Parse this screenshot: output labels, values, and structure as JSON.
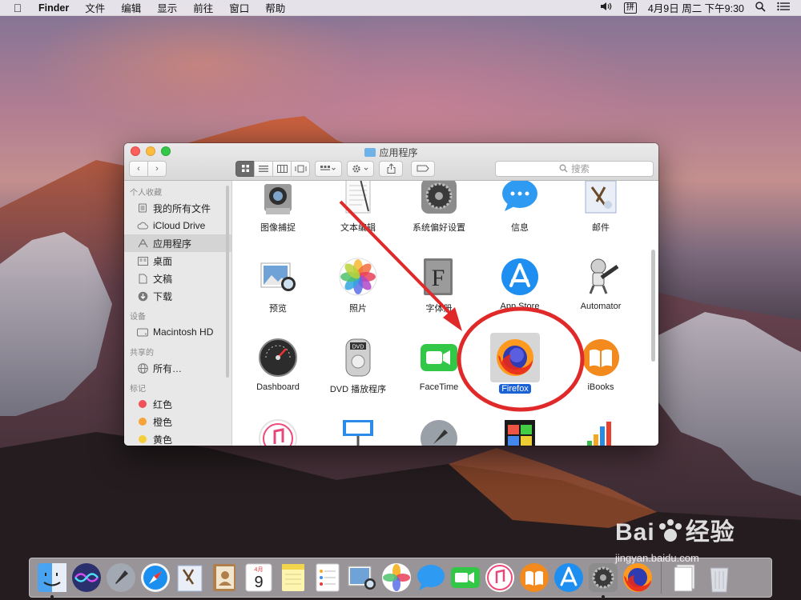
{
  "menubar": {
    "app_name": "Finder",
    "items": [
      "文件",
      "编辑",
      "显示",
      "前往",
      "窗口",
      "帮助"
    ],
    "ime": "拼",
    "clock": "4月9日 周二 下午9:30"
  },
  "window": {
    "title": "应用程序",
    "search_placeholder": "搜索"
  },
  "sidebar": {
    "favorites_header": "个人收藏",
    "favorites": [
      "我的所有文件",
      "iCloud Drive",
      "应用程序",
      "桌面",
      "文稿",
      "下载"
    ],
    "devices_header": "设备",
    "devices": [
      "Macintosh HD"
    ],
    "shared_header": "共享的",
    "shared": [
      "所有…"
    ],
    "tags_header": "标记",
    "tags": [
      {
        "label": "红色",
        "color": "#f0525a"
      },
      {
        "label": "橙色",
        "color": "#f6a33a"
      },
      {
        "label": "黄色",
        "color": "#f4cf3a"
      }
    ]
  },
  "apps": [
    {
      "label": "图像捕捉",
      "icon": "image-capture-icon"
    },
    {
      "label": "文本编辑",
      "icon": "textedit-icon"
    },
    {
      "label": "系统偏好设置",
      "icon": "system-preferences-icon"
    },
    {
      "label": "信息",
      "icon": "messages-icon"
    },
    {
      "label": "邮件",
      "icon": "mail-icon"
    },
    {
      "label": "预览",
      "icon": "preview-icon"
    },
    {
      "label": "照片",
      "icon": "photos-icon"
    },
    {
      "label": "字体册",
      "icon": "font-book-icon"
    },
    {
      "label": "App Store",
      "icon": "app-store-icon"
    },
    {
      "label": "Automator",
      "icon": "automator-icon"
    },
    {
      "label": "Dashboard",
      "icon": "dashboard-icon"
    },
    {
      "label": "DVD 播放程序",
      "icon": "dvd-player-icon"
    },
    {
      "label": "FaceTime",
      "icon": "facetime-icon"
    },
    {
      "label": "Firefox",
      "icon": "firefox-icon",
      "selected": true
    },
    {
      "label": "iBooks",
      "icon": "ibooks-icon"
    }
  ],
  "dock": {
    "items": [
      "finder-icon",
      "siri-icon",
      "launchpad-icon",
      "safari-icon",
      "mail-icon",
      "contacts-icon",
      "calendar-icon",
      "notes-icon",
      "reminders-icon",
      "preview-icon",
      "photos-icon",
      "messages-icon",
      "facetime-icon",
      "itunes-icon",
      "ibooks-icon",
      "app-store-icon",
      "system-preferences-icon",
      "firefox-icon",
      "trash-icon"
    ],
    "calendar_month": "4月",
    "calendar_day": "9"
  },
  "watermark": {
    "brand": "Bai",
    "brand2": "经验",
    "url": "jingyan.baidu.com"
  },
  "colors": {
    "selection": "#1a62d6",
    "annotation": "#e02a2a"
  }
}
